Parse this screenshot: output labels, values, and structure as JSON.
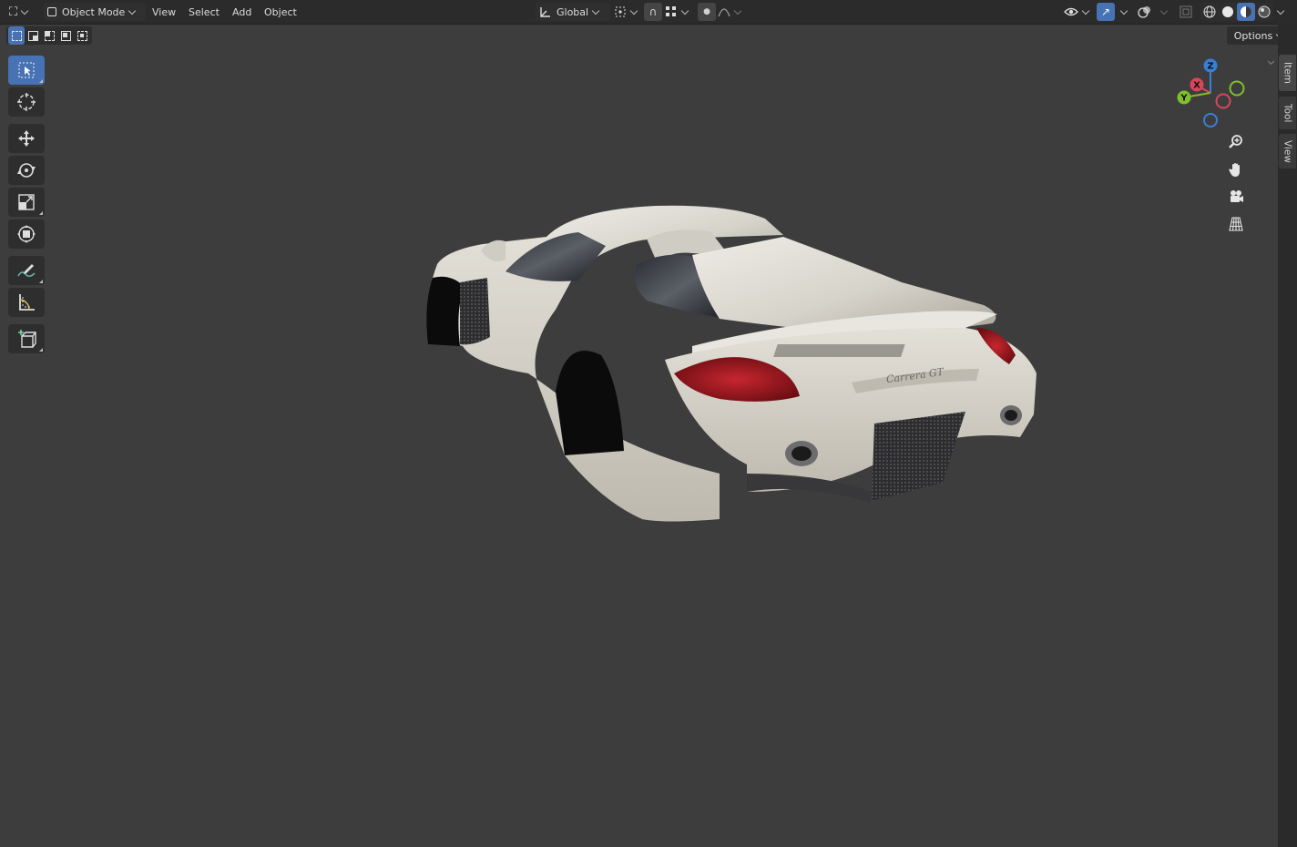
{
  "header": {
    "mode_label": "Object Mode",
    "menus": [
      "View",
      "Select",
      "Add",
      "Object"
    ],
    "orientation_label": "Global"
  },
  "viewport": {
    "options_label": "Options",
    "side_tabs": [
      "Item",
      "Tool",
      "View"
    ]
  },
  "toolbar": {
    "tools": [
      {
        "name": "select-box",
        "icon": "select-box-icon",
        "active": true
      },
      {
        "name": "cursor",
        "icon": "cursor-icon"
      },
      {
        "name": "move",
        "icon": "move-icon"
      },
      {
        "name": "rotate",
        "icon": "rotate-icon"
      },
      {
        "name": "scale",
        "icon": "scale-icon"
      },
      {
        "name": "transform",
        "icon": "transform-icon"
      },
      {
        "name": "annotate",
        "icon": "annotate-icon"
      },
      {
        "name": "measure",
        "icon": "measure-icon"
      },
      {
        "name": "add-cube",
        "icon": "add-cube-icon"
      }
    ]
  },
  "gizmo": {
    "axes": [
      "Z",
      "X",
      "Y"
    ],
    "colors": {
      "x": "#d9465c",
      "y": "#7fbf2a",
      "z": "#3a7fd4"
    }
  },
  "scene": {
    "badge_text": "Carrera GT",
    "body_color": "#d8d5cc",
    "light_color": "#a5161f"
  },
  "theme": {
    "accent": "#4772b3",
    "viewport_bg": "#3d3d3d",
    "header_bg": "#2b2b2b"
  }
}
